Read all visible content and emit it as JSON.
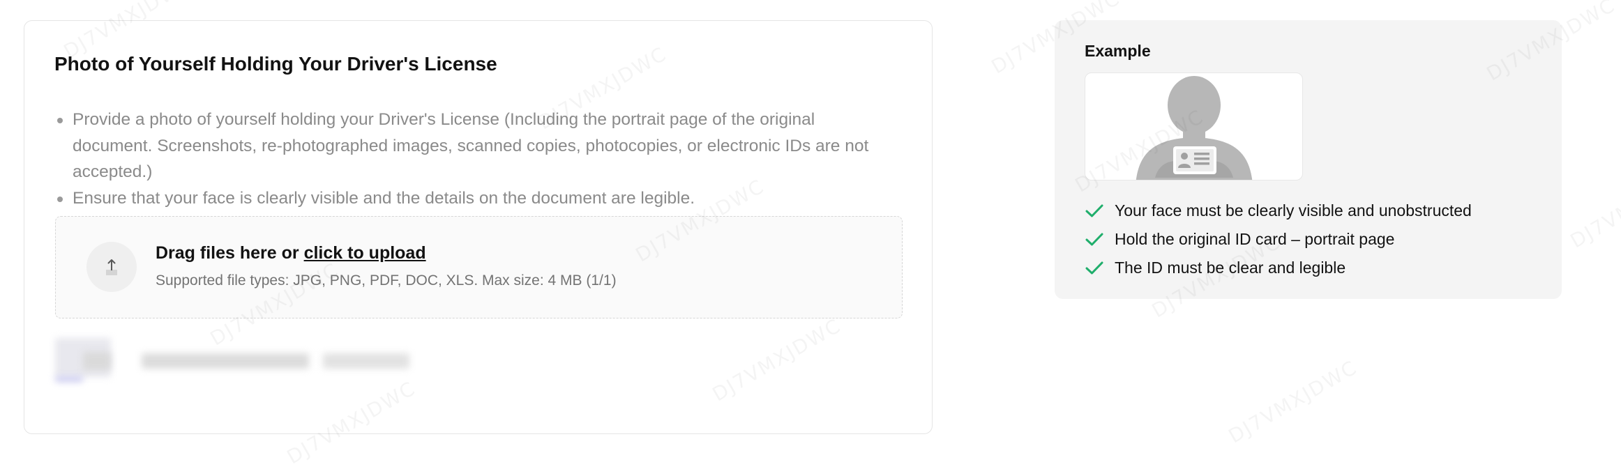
{
  "upload": {
    "title": "Photo of Yourself Holding Your Driver's License",
    "requirements": [
      "Provide a photo of yourself holding your Driver's License (Including the portrait page of the original document. Screenshots, re-photographed images, scanned copies, photocopies, or electronic IDs are not accepted.)",
      "Ensure that your face is clearly visible and the details on the document are legible."
    ],
    "dropzone": {
      "prompt": "Drag files here or ",
      "link": "click to upload",
      "hint": "Supported file types: JPG, PNG, PDF, DOC, XLS. Max size: 4 MB (1/1)",
      "icon": "upload-arrow-icon"
    }
  },
  "example": {
    "title": "Example",
    "checks": [
      "Your face must be clearly visible and unobstructed",
      "Hold the original ID card – portrait page",
      "The ID must be clear and legible"
    ],
    "check_color": "#1fae6b"
  },
  "watermark": "DJ7VMXJDWC"
}
